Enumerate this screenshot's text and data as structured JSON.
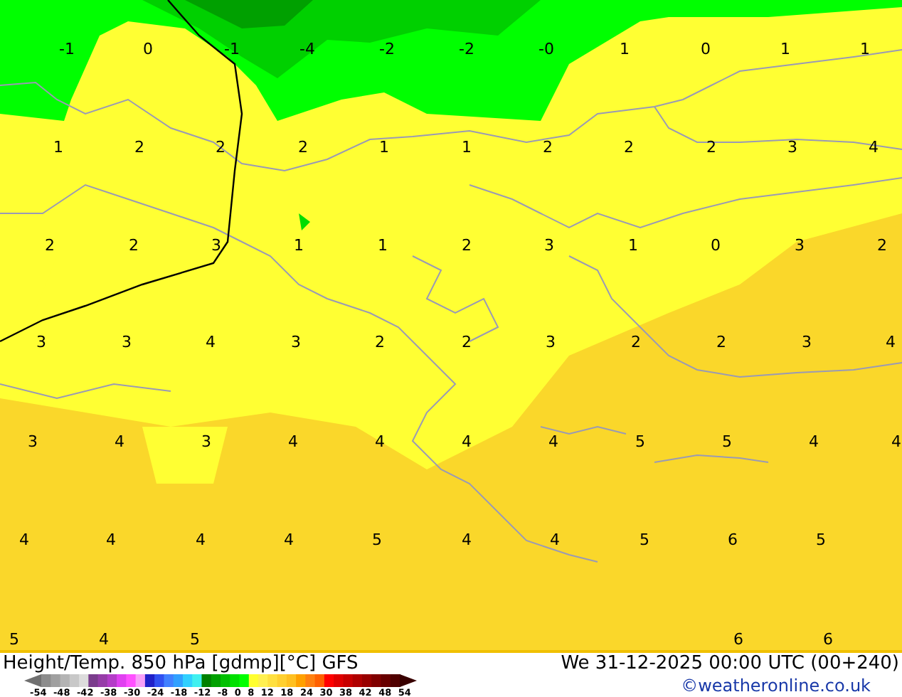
{
  "map": {
    "value_rows": [
      [
        "-1",
        "0",
        "-1",
        "-4",
        "-2",
        "-2",
        "-0",
        "1",
        "0",
        "1",
        "1"
      ],
      [
        "1",
        "2",
        "2",
        "2",
        "1",
        "1",
        "2",
        "2",
        "2",
        "3",
        "4"
      ],
      [
        "2",
        "2",
        "3",
        "1",
        "1",
        "2",
        "3",
        "1",
        "0",
        "3",
        "2"
      ],
      [
        "3",
        "3",
        "4",
        "3",
        "2",
        "2",
        "3",
        "2",
        "2",
        "3",
        "4"
      ],
      [
        "3",
        "4",
        "3",
        "4",
        "4",
        "4",
        "4",
        "5",
        "5",
        "4",
        "4"
      ],
      [
        "4",
        "4",
        "4",
        "4",
        "5",
        "4",
        "4",
        "5",
        "6",
        "5"
      ],
      [
        "5",
        "4",
        "5",
        "6",
        "6"
      ]
    ]
  },
  "footer": {
    "title": "Height/Temp. 850 hPa [gdmp][°C] GFS",
    "valid_time": "We 31-12-2025 00:00 UTC (00+240)",
    "scale_labels": [
      "-54",
      "-48",
      "-42",
      "-38",
      "-30",
      "-24",
      "-18",
      "-12",
      "-8",
      "0",
      "8",
      "12",
      "18",
      "24",
      "30",
      "38",
      "42",
      "48",
      "54"
    ],
    "credit": "©weatheronline.co.uk"
  }
}
